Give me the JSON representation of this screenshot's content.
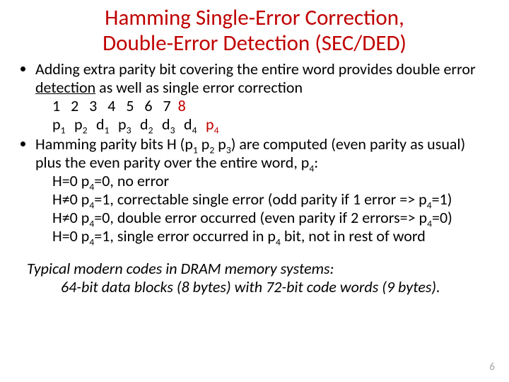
{
  "title_line1": "Hamming Single-Error Correction,",
  "title_line2": "Double-Error Detection (SEC/DED)",
  "bullet1_pre": "Adding extra parity bit covering the entire word provides double error ",
  "bullet1_under": "detection",
  "bullet1_post": " as well as single error correction",
  "positions": {
    "p1": "1",
    "p2": "2",
    "p3": "3",
    "p4": "4",
    "p5": "5",
    "p6": "6",
    "p7": "7",
    "p8": "8"
  },
  "labels": {
    "l1a": "p",
    "l1b": "1",
    "l2a": "p",
    "l2b": "2",
    "l3a": "d",
    "l3b": "1",
    "l4a": "p",
    "l4b": "3",
    "l5a": "d",
    "l5b": "2",
    "l6a": "d",
    "l6b": "3",
    "l7a": "d",
    "l7b": "4",
    "l8a": "p",
    "l8b": "4"
  },
  "bullet2_a": "Hamming parity bits H (p",
  "bullet2_b": "1",
  "bullet2_c": "  p",
  "bullet2_d": "2",
  "bullet2_e": " p",
  "bullet2_f": "3",
  "bullet2_g": ") are computed (even parity as usual) plus the even parity over the entire word, p",
  "bullet2_h": "4",
  "bullet2_i": ":",
  "case1_a": "H=0 p",
  "case1_b": "4",
  "case1_c": "=0, no error",
  "case2_a": "H≠0 p",
  "case2_b": "4",
  "case2_c": "=1, correctable single error (odd parity if 1 error => p",
  "case2_d": "4",
  "case2_e": "=1)",
  "case3_a": "H≠0 p",
  "case3_b": "4",
  "case3_c": "=0, double error occurred (even parity if 2 errors=> p",
  "case3_d": "4",
  "case3_e": "=0)",
  "case4_a": "H=0 p",
  "case4_b": "4",
  "case4_c": "=1, single error occurred in p",
  "case4_d": "4",
  "case4_e": " bit, not in rest of word",
  "typical_l1": "Typical modern codes in DRAM memory systems:",
  "typical_l2": "64-bit data blocks (8 bytes) with 72-bit code words (9 bytes).",
  "pagenum": "6"
}
